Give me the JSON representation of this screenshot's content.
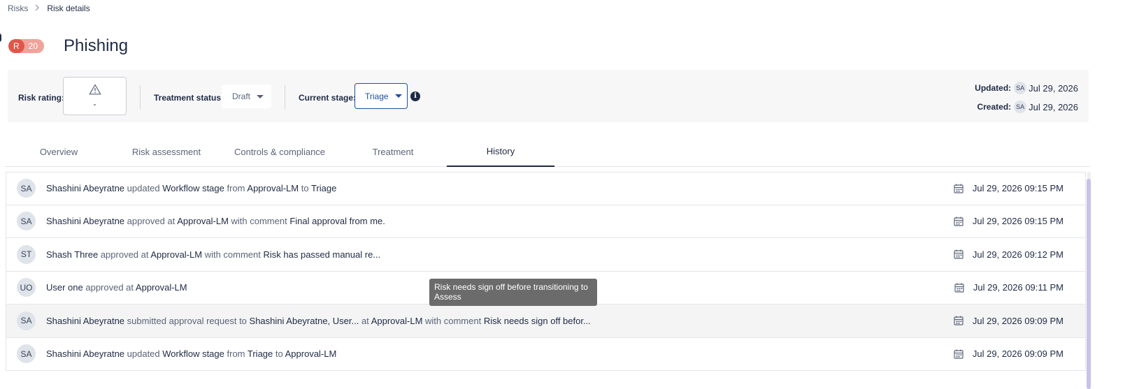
{
  "breadcrumb": {
    "parent": "Risks",
    "separator": ">",
    "current": "Risk details"
  },
  "risk": {
    "badge_letter": "R",
    "badge_score": "20",
    "badge_color": "#e0574a",
    "title": "Phishing"
  },
  "panel": {
    "rating_label": "Risk rating:",
    "rating_icon": "warning-triangle-icon",
    "rating_value": "-",
    "treatment_label": "Treatment status:",
    "treatment_value": "Draft",
    "stage_label": "Current stage:",
    "stage_value": "Triage",
    "info_icon": "i",
    "updated_label": "Updated:",
    "updated_initials": "SA",
    "updated_date": "Jul 29, 2026",
    "created_label": "Created:",
    "created_initials": "SA",
    "created_date": "Jul 29, 2026"
  },
  "tabs": [
    {
      "label": "Overview"
    },
    {
      "label": "Risk assessment"
    },
    {
      "label": "Controls & compliance"
    },
    {
      "label": "Treatment"
    },
    {
      "label": "History",
      "active": true
    }
  ],
  "history": [
    {
      "initials": "SA",
      "actor": "Shashini Abeyratne",
      "verb1": " updated ",
      "obj1": "Workflow stage",
      "verb2": " from ",
      "obj2": "Approval-LM",
      "verb3": " to ",
      "obj3": "Triage",
      "verb4": "",
      "obj4": "",
      "time": "Jul 29, 2026 09:15 PM"
    },
    {
      "initials": "SA",
      "actor": "Shashini Abeyratne",
      "verb1": " approved at ",
      "obj1": "Approval-LM",
      "verb2": " with comment ",
      "obj2": "Final approval from me.",
      "verb3": "",
      "obj3": "",
      "verb4": "",
      "obj4": "",
      "time": "Jul 29, 2026 09:15 PM"
    },
    {
      "initials": "ST",
      "actor": "Shash Three",
      "verb1": " approved at ",
      "obj1": "Approval-LM",
      "verb2": " with comment ",
      "obj2": "Risk has passed manual re...",
      "verb3": "",
      "obj3": "",
      "verb4": "",
      "obj4": "",
      "time": "Jul 29, 2026 09:12 PM"
    },
    {
      "initials": "UO",
      "actor": "User one",
      "verb1": " approved at ",
      "obj1": "Approval-LM",
      "verb2": "",
      "obj2": "",
      "verb3": "",
      "obj3": "",
      "verb4": "",
      "obj4": "",
      "time": "Jul 29, 2026 09:11 PM"
    },
    {
      "initials": "SA",
      "actor": "Shashini Abeyratne",
      "verb1": " submitted approval request to ",
      "obj1": "Shashini Abeyratne, User...",
      "verb2": " at ",
      "obj2": "Approval-LM",
      "verb3": " with comment ",
      "obj3": "Risk needs sign off befor...",
      "verb4": "",
      "obj4": "",
      "time": "Jul 29, 2026 09:09 PM"
    },
    {
      "initials": "SA",
      "actor": "Shashini Abeyratne",
      "verb1": " updated ",
      "obj1": "Workflow stage",
      "verb2": " from ",
      "obj2": "Triage",
      "verb3": " to ",
      "obj3": "Approval-LM",
      "verb4": "",
      "obj4": "",
      "time": "Jul 29, 2026 09:09 PM"
    }
  ],
  "tooltip": {
    "text": "Risk needs sign off before transitioning to Assess"
  },
  "colors": {
    "accent": "#1e4fa3",
    "text": "#1f2a44",
    "muted": "#5b6478",
    "scroll_thumb": "#c6c3ea",
    "tooltip_bg": "#6b6b6b"
  }
}
